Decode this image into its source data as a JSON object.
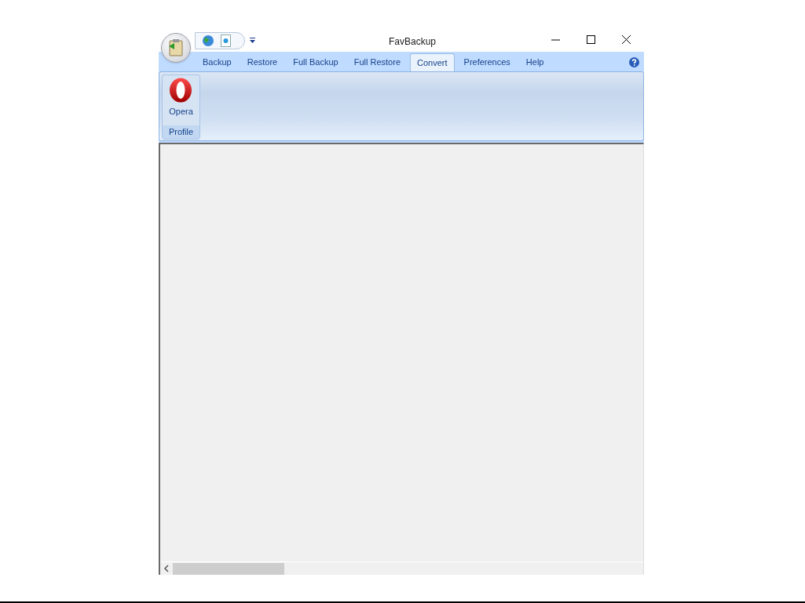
{
  "window": {
    "title": "FavBackup"
  },
  "tabs": [
    {
      "label": "Backup",
      "selected": false
    },
    {
      "label": "Restore",
      "selected": false
    },
    {
      "label": "Full Backup",
      "selected": false
    },
    {
      "label": "Full Restore",
      "selected": false
    },
    {
      "label": "Convert",
      "selected": true
    },
    {
      "label": "Preferences",
      "selected": false
    },
    {
      "label": "Help",
      "selected": false
    }
  ],
  "ribbon": {
    "groups": [
      {
        "label": "Profile",
        "buttons": [
          {
            "label": "Opera"
          }
        ]
      }
    ]
  }
}
